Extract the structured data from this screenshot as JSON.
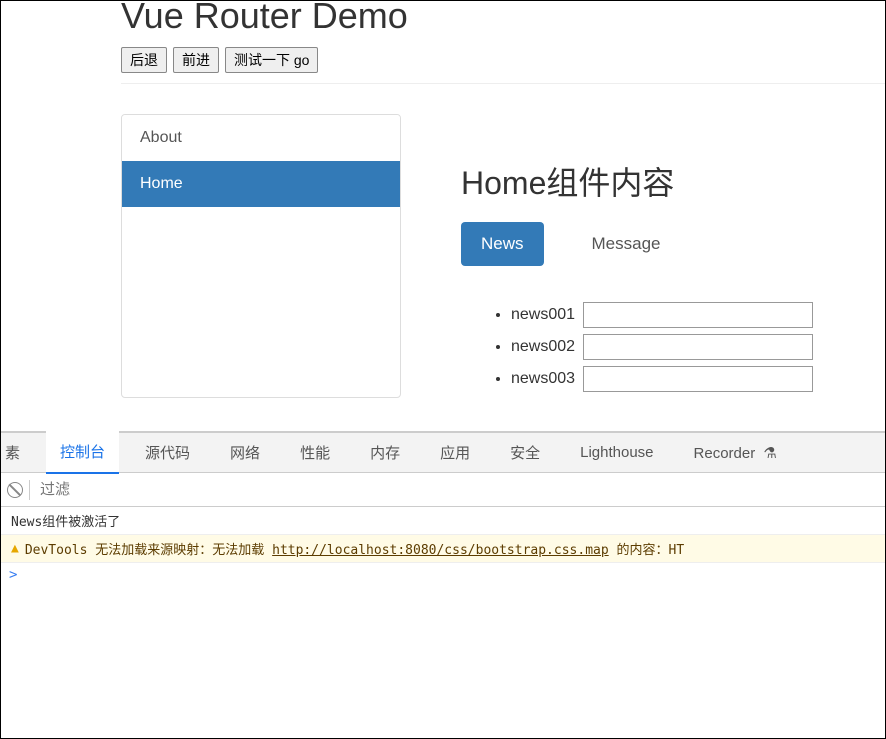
{
  "page": {
    "title": "Vue Router Demo",
    "buttons": {
      "back": "后退",
      "forward": "前进",
      "test_go": "测试一下 go"
    }
  },
  "sidebar": {
    "items": [
      {
        "label": "About",
        "active": false
      },
      {
        "label": "Home",
        "active": true
      }
    ]
  },
  "content": {
    "title": "Home组件内容",
    "tabs": [
      {
        "label": "News",
        "active": true
      },
      {
        "label": "Message",
        "active": false
      }
    ],
    "news_items": [
      {
        "label": "news001",
        "value": ""
      },
      {
        "label": "news002",
        "value": ""
      },
      {
        "label": "news003",
        "value": ""
      }
    ]
  },
  "devtools": {
    "tabs": {
      "elements_partial": "素",
      "console": "控制台",
      "sources": "源代码",
      "network": "网络",
      "performance": "性能",
      "memory": "内存",
      "application": "应用",
      "security": "安全",
      "lighthouse": "Lighthouse",
      "recorder": "Recorder"
    },
    "filter_placeholder": "过滤",
    "console": {
      "log1": "News组件被激活了",
      "warn_prefix": "DevTools",
      "warn_mid1": "无法加载来源映射：无法加载",
      "warn_link": "http://localhost:8080/css/bootstrap.css.map",
      "warn_suffix": "的内容：HT",
      "prompt": ">"
    }
  }
}
